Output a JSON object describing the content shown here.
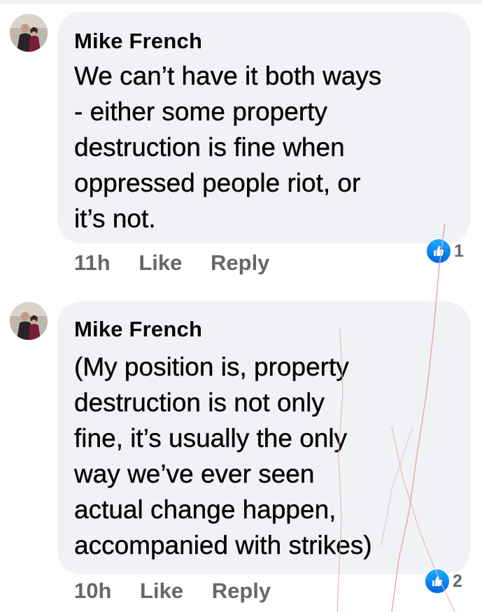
{
  "comments": [
    {
      "author": "Mike French",
      "text": "We can’t have it both ways\n- either some property\ndestruction is fine when\noppressed people riot, or\nit’s not.",
      "time": "11h",
      "like_label": "Like",
      "reply_label": "Reply",
      "reaction_count": "1"
    },
    {
      "author": "Mike French",
      "text": "(My position is, property\ndestruction is not only\nfine, it’s usually the only\nway we’ve ever seen\nactual change happen,\naccompanied with strikes)",
      "time": "10h",
      "like_label": "Like",
      "reply_label": "Reply",
      "reaction_count": "2"
    }
  ],
  "reaction_icon": "thumbs-up-icon",
  "colors": {
    "bubble": "#f0f2f5",
    "text": "#050505",
    "meta": "#65676b",
    "like_blue": "#1877f2"
  }
}
